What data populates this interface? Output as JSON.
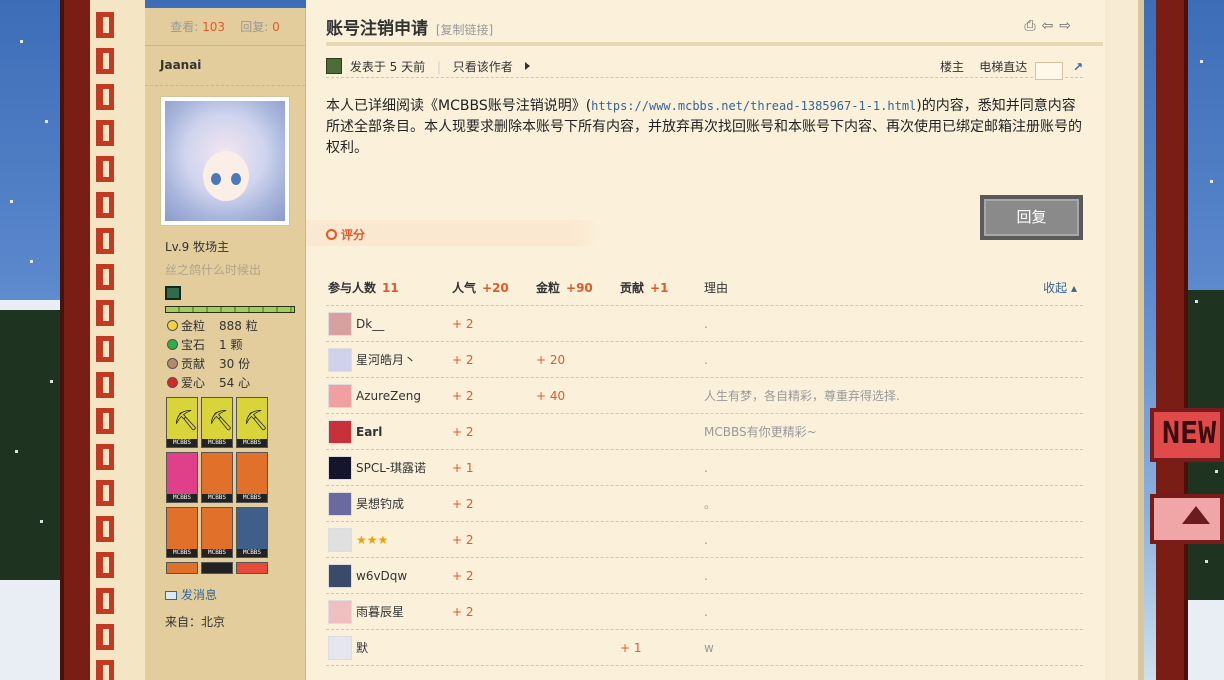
{
  "author": {
    "views_label": "查看:",
    "views": "103",
    "replies_label": "回复:",
    "replies": "0",
    "name": "Jaanai",
    "level": "Lv.9 牧场主",
    "subtitle": "丝之鸽什么时候出",
    "resources": [
      {
        "icon": "gold-nugget-icon",
        "label": "金粒",
        "value": "888 粒",
        "color": "#f2d33a"
      },
      {
        "icon": "emerald-icon",
        "label": "宝石",
        "value": "1 颗",
        "color": "#2fae47"
      },
      {
        "icon": "contribution-icon",
        "label": "贡献",
        "value": "30 份",
        "color": "#b58a6a"
      },
      {
        "icon": "heart-icon",
        "label": "爱心",
        "value": "54 心",
        "color": "#d8262a"
      }
    ],
    "medal_badge": "MCBBS",
    "send_message": "发消息",
    "from": "来自：北京"
  },
  "post": {
    "title": "账号注销申请",
    "copy_link": "[复制链接]",
    "posted": "发表于 5 天前",
    "view_author": "只看该作者",
    "floor": "楼主",
    "elevator": "电梯直达",
    "content_before": "本人已详细阅读《MCBBS账号注销说明》(",
    "content_link": "https://www.mcbbs.net/thread-1385967-1-1.html",
    "content_after": ")的内容，悉知并同意内容所述全部条目。本人现要求删除本账号下所有内容，并放弃再次找回账号和本账号下内容、再次使用已绑定邮箱注册账号的权利。",
    "reply_button": "回复",
    "rate_label": "评分"
  },
  "ratings": {
    "header": {
      "participants_label": "参与人数",
      "participants": "11",
      "popularity_label": "人气",
      "popularity": "+20",
      "gold_label": "金粒",
      "gold": "+90",
      "contribution_label": "贡献",
      "contribution": "+1",
      "reason_label": "理由",
      "collapse": "收起"
    },
    "rows": [
      {
        "name": "Dk__",
        "popularity": "+ 2",
        "gold": "",
        "contribution": "",
        "reason": "."
      },
      {
        "name": "星河皓月丶",
        "popularity": "+ 2",
        "gold": "+ 20",
        "contribution": "",
        "reason": "."
      },
      {
        "name": "AzureZeng",
        "popularity": "+ 2",
        "gold": "+ 40",
        "contribution": "",
        "reason": "人生有梦，各自精彩，尊重弃得选择."
      },
      {
        "name": "Earl",
        "popularity": "+ 2",
        "gold": "",
        "contribution": "",
        "reason": "MCBBS有你更精彩~"
      },
      {
        "name": "SPCL-琪露诺",
        "popularity": "+ 1",
        "gold": "",
        "contribution": "",
        "reason": "."
      },
      {
        "name": "昊想钓成",
        "popularity": "+ 2",
        "gold": "",
        "contribution": "",
        "reason": "。"
      },
      {
        "name": "★★★",
        "popularity": "+ 2",
        "gold": "",
        "contribution": "",
        "reason": "."
      },
      {
        "name": "w6vDqw",
        "popularity": "+ 2",
        "gold": "",
        "contribution": "",
        "reason": "."
      },
      {
        "name": "雨暮辰星",
        "popularity": "+ 2",
        "gold": "",
        "contribution": "",
        "reason": "."
      },
      {
        "name": "默",
        "popularity": "",
        "gold": "",
        "contribution": "+ 1",
        "reason": "w"
      }
    ]
  },
  "side_tab_new": "NEW"
}
